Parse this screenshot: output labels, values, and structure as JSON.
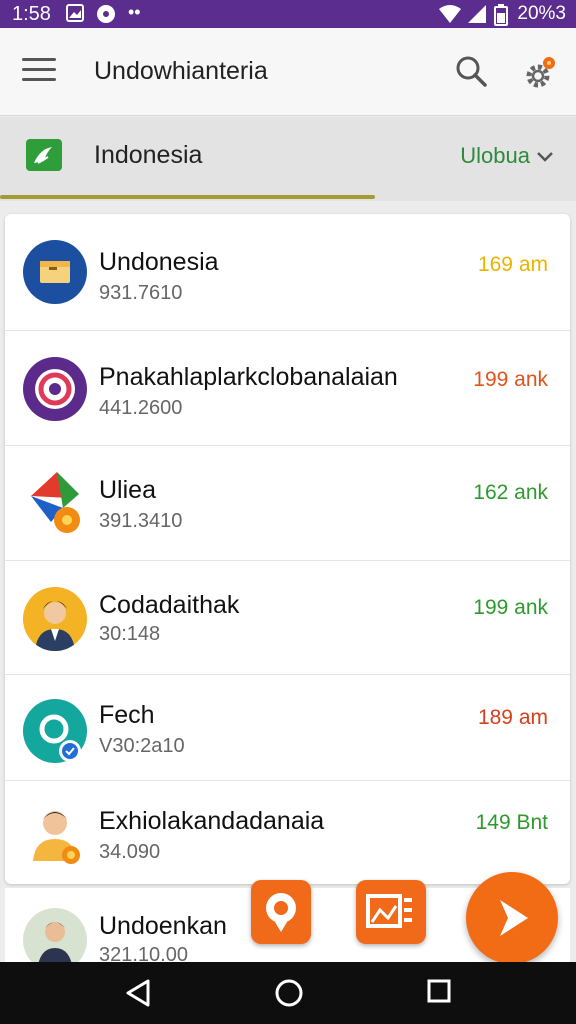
{
  "status_bar": {
    "time": "1:58",
    "right_text": "20%3"
  },
  "app_bar": {
    "title": "Undowhianteria"
  },
  "country_bar": {
    "label": "Indonesia",
    "selector": "Ulobua"
  },
  "list": [
    {
      "name": "Undonesia",
      "sub": "931.7610",
      "stat": "169 am",
      "stat_color": "#e8b400"
    },
    {
      "name": "Pnakahlaplarkclobanalaian",
      "sub": "441.2600",
      "stat": "199 ank",
      "stat_color": "#e0541c"
    },
    {
      "name": "Uliea",
      "sub": "391.3410",
      "stat": "162 ank",
      "stat_color": "#2d9a2d"
    },
    {
      "name": "Codadaithak",
      "sub": "30:148",
      "stat": "199 ank",
      "stat_color": "#2d9a2d"
    },
    {
      "name": "Fech",
      "sub": "V30:2a10",
      "stat": "189 am",
      "stat_color": "#d8401c"
    },
    {
      "name": "Exhiolakandadanaia",
      "sub": "34.090",
      "stat": "149 Bnt",
      "stat_color": "#2d9a2d"
    }
  ],
  "partial_row": {
    "name": "Undoenkan",
    "sub": "321.10.00"
  },
  "icons": {
    "menu": "menu-icon",
    "search": "search-icon",
    "settings": "gear-icon",
    "chevron": "chevron-down-icon",
    "fab_main": "send-icon",
    "nav_back": "back-icon",
    "nav_home": "home-icon",
    "nav_recents": "recents-icon"
  },
  "colors": {
    "status_bar": "#5b2d8e",
    "accent_orange": "#f26b15",
    "accent_green": "#2e8b3d"
  }
}
